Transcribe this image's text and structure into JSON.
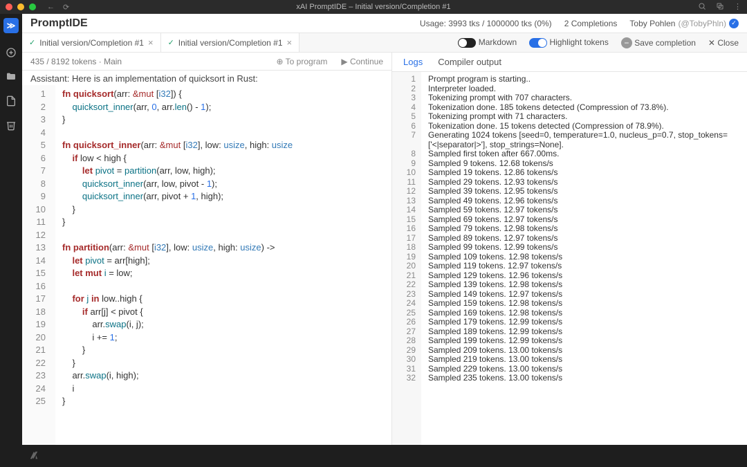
{
  "titlebar": {
    "title": "xAI PromptIDE – Initial version/Completion #1"
  },
  "app": {
    "name": "PromptIDE"
  },
  "header": {
    "usage": "Usage: 3993 tks / 1000000 tks (0%)",
    "completions": "2 Completions",
    "user_name": "Toby Pohlen",
    "user_handle": "(@TobyPhln)"
  },
  "tabs": [
    {
      "label": "Initial version/Completion #1"
    },
    {
      "label": "Initial version/Completion #1"
    }
  ],
  "toolbar": {
    "markdown": "Markdown",
    "highlight": "Highlight tokens",
    "save": "Save completion",
    "close": "Close"
  },
  "substatus": {
    "tokens": "435 / 8192 tokens · Main",
    "to_program": "To program",
    "continue": "Continue"
  },
  "conversation_line": "Assistant: Here is an implementation of quicksort in Rust:",
  "code_lines": [
    {
      "n": 1,
      "html": "<span class='kw'>fn</span> <span class='fn'>quicksort</span>(arr: <span class='op'>&amp;mut</span> [<span class='ty'>i32</span>]) {"
    },
    {
      "n": 2,
      "html": "    <span class='nm'>quicksort_inner</span>(arr, <span class='num'>0</span>, arr.<span class='nm'>len</span>() - <span class='num'>1</span>);"
    },
    {
      "n": 3,
      "html": "}"
    },
    {
      "n": 4,
      "html": ""
    },
    {
      "n": 5,
      "html": "<span class='kw'>fn</span> <span class='fn'>quicksort_inner</span>(arr: <span class='op'>&amp;mut</span> [<span class='ty'>i32</span>], low: <span class='ty'>usize</span>, high: <span class='ty'>usize</span>"
    },
    {
      "n": 6,
      "html": "    <span class='kw'>if</span> low &lt; high {"
    },
    {
      "n": 7,
      "html": "        <span class='kw'>let</span> <span class='nm'>pivot</span> = <span class='nm'>partition</span>(arr, low, high);"
    },
    {
      "n": 8,
      "html": "        <span class='nm'>quicksort_inner</span>(arr, low, pivot - <span class='num'>1</span>);"
    },
    {
      "n": 9,
      "html": "        <span class='nm'>quicksort_inner</span>(arr, pivot + <span class='num'>1</span>, high);"
    },
    {
      "n": 10,
      "html": "    }"
    },
    {
      "n": 11,
      "html": "}"
    },
    {
      "n": 12,
      "html": ""
    },
    {
      "n": 13,
      "html": "<span class='kw'>fn</span> <span class='fn'>partition</span>(arr: <span class='op'>&amp;mut</span> [<span class='ty'>i32</span>], low: <span class='ty'>usize</span>, high: <span class='ty'>usize</span>) -&gt; "
    },
    {
      "n": 14,
      "html": "    <span class='kw'>let</span> <span class='nm'>pivot</span> = arr[high];"
    },
    {
      "n": 15,
      "html": "    <span class='kw'>let mut</span> <span class='nm'>i</span> = low;"
    },
    {
      "n": 16,
      "html": ""
    },
    {
      "n": 17,
      "html": "    <span class='kw'>for</span> <span class='nm'>j</span> <span class='kw'>in</span> low..high {"
    },
    {
      "n": 18,
      "html": "        <span class='kw'>if</span> arr[j] &lt; pivot {"
    },
    {
      "n": 19,
      "html": "            arr.<span class='nm'>swap</span>(i, j);"
    },
    {
      "n": 20,
      "html": "            i += <span class='num'>1</span>;"
    },
    {
      "n": 21,
      "html": "        }"
    },
    {
      "n": 22,
      "html": "    }"
    },
    {
      "n": 23,
      "html": "    arr.<span class='nm'>swap</span>(i, high);"
    },
    {
      "n": 24,
      "html": "    i"
    },
    {
      "n": 25,
      "html": "}"
    }
  ],
  "rtabs": {
    "logs": "Logs",
    "compiler": "Compiler output"
  },
  "log_lines": [
    "Prompt program is starting..",
    "Interpreter loaded.",
    "Tokenizing prompt with 707 characters.",
    "Tokenization done. 185 tokens detected (Compression of 73.8%).",
    "Tokenizing prompt with 71 characters.",
    "Tokenization done. 15 tokens detected (Compression of 78.9%).",
    "Generating 1024 tokens [seed=0, temperature=1.0, nucleus_p=0.7, stop_tokens=['<|separator|>'], stop_strings=None].",
    "Sampled first token after 667.00ms.",
    "Sampled 9 tokens. 12.68 tokens/s",
    "Sampled 19 tokens. 12.86 tokens/s",
    "Sampled 29 tokens. 12.93 tokens/s",
    "Sampled 39 tokens. 12.95 tokens/s",
    "Sampled 49 tokens. 12.96 tokens/s",
    "Sampled 59 tokens. 12.97 tokens/s",
    "Sampled 69 tokens. 12.97 tokens/s",
    "Sampled 79 tokens. 12.98 tokens/s",
    "Sampled 89 tokens. 12.97 tokens/s",
    "Sampled 99 tokens. 12.99 tokens/s",
    "Sampled 109 tokens. 12.98 tokens/s",
    "Sampled 119 tokens. 12.97 tokens/s",
    "Sampled 129 tokens. 12.96 tokens/s",
    "Sampled 139 tokens. 12.98 tokens/s",
    "Sampled 149 tokens. 12.97 tokens/s",
    "Sampled 159 tokens. 12.98 tokens/s",
    "Sampled 169 tokens. 12.98 tokens/s",
    "Sampled 179 tokens. 12.99 tokens/s",
    "Sampled 189 tokens. 12.99 tokens/s",
    "Sampled 199 tokens. 12.99 tokens/s",
    "Sampled 209 tokens. 13.00 tokens/s",
    "Sampled 219 tokens. 13.00 tokens/s",
    "Sampled 229 tokens. 13.00 tokens/s",
    "Sampled 235 tokens. 13.00 tokens/s"
  ]
}
